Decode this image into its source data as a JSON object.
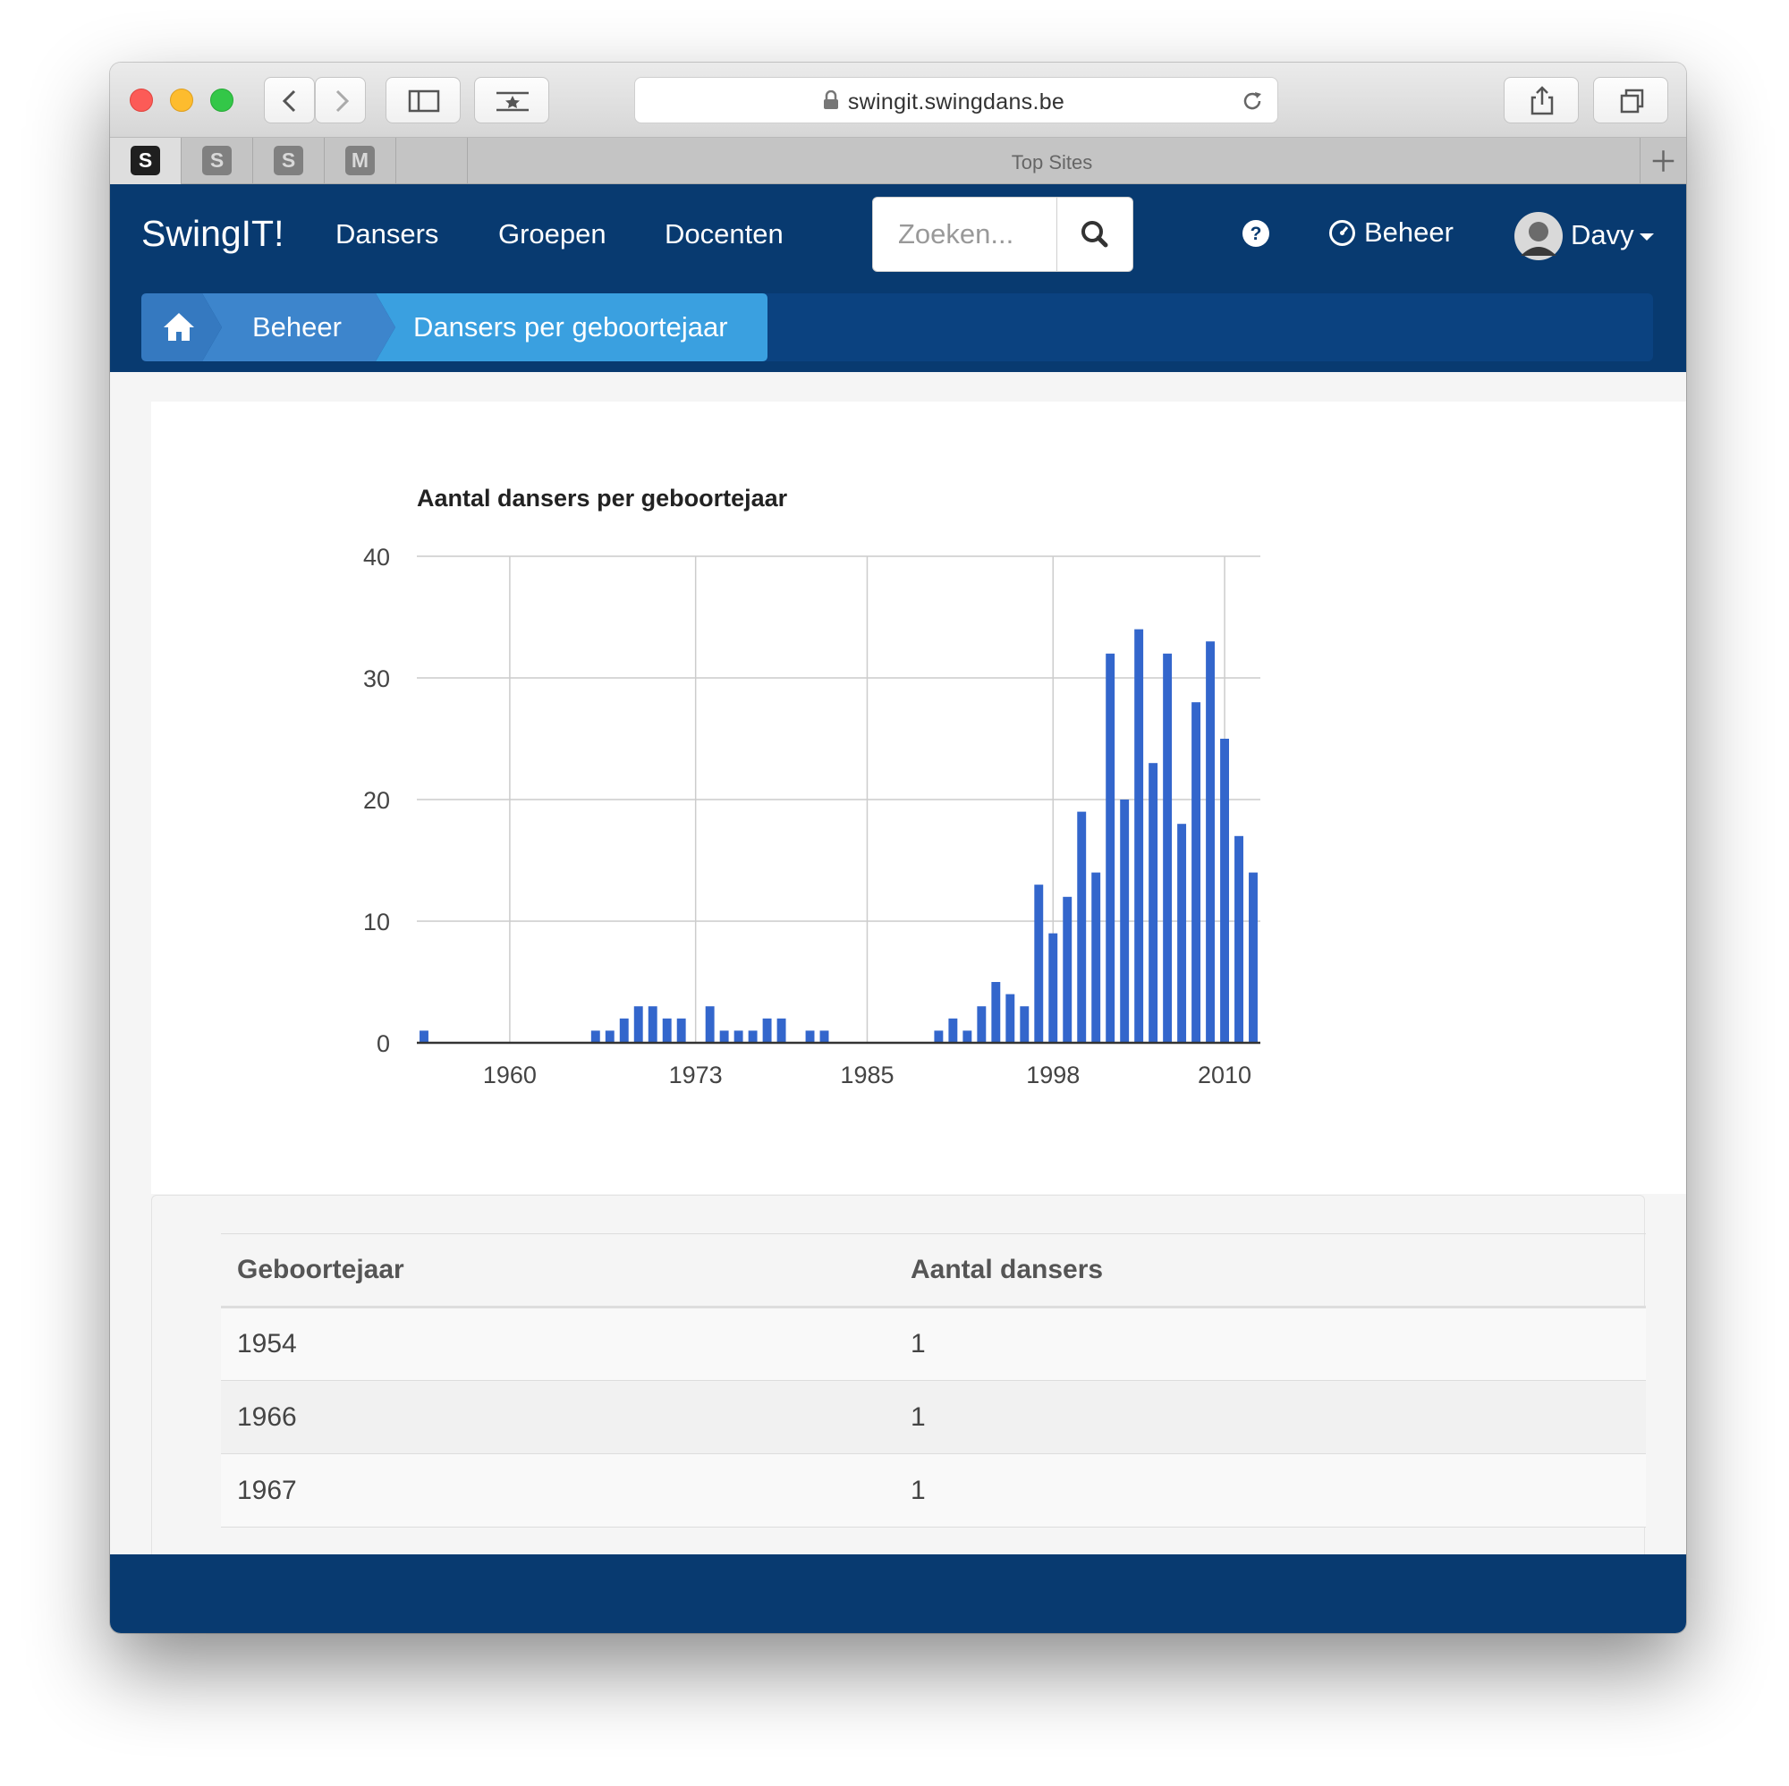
{
  "browser": {
    "url": "swingit.swingdans.be",
    "tab_title": "Top Sites",
    "pinned_tabs": [
      "S",
      "S",
      "S",
      "M"
    ]
  },
  "navbar": {
    "brand": "SwingIT!",
    "links": [
      "Dansers",
      "Groepen",
      "Docenten"
    ],
    "search_placeholder": "Zoeken...",
    "beheer_label": "Beheer",
    "user_name": "Davy"
  },
  "breadcrumb": {
    "items": [
      "Beheer",
      "Dansers per geboortejaar"
    ]
  },
  "chart_data": {
    "type": "bar",
    "title": "Aantal dansers per geboortejaar",
    "xlabel": "",
    "ylabel": "",
    "x_ticks": [
      "1960",
      "1973",
      "1985",
      "1998",
      "2010"
    ],
    "y_ticks": [
      "0",
      "10",
      "20",
      "30",
      "40"
    ],
    "ylim": [
      0,
      40
    ],
    "xlim": [
      1953.5,
      2012.5
    ],
    "grid": true,
    "color": "#3366cc",
    "x": [
      1954,
      1966,
      1967,
      1968,
      1969,
      1970,
      1971,
      1972,
      1974,
      1975,
      1976,
      1977,
      1978,
      1979,
      1981,
      1982,
      1990,
      1991,
      1992,
      1993,
      1994,
      1995,
      1996,
      1997,
      1998,
      1999,
      2000,
      2001,
      2002,
      2003,
      2004,
      2005,
      2006,
      2007,
      2008,
      2009,
      2010,
      2011,
      2012
    ],
    "values": [
      1,
      1,
      1,
      2,
      3,
      3,
      2,
      2,
      3,
      1,
      1,
      1,
      2,
      2,
      1,
      1,
      1,
      2,
      1,
      3,
      5,
      4,
      3,
      13,
      9,
      12,
      19,
      14,
      32,
      20,
      34,
      23,
      32,
      18,
      28,
      33,
      25,
      17,
      14
    ]
  },
  "table": {
    "headers": [
      "Geboortejaar",
      "Aantal dansers"
    ],
    "rows": [
      [
        "1954",
        "1"
      ],
      [
        "1966",
        "1"
      ],
      [
        "1967",
        "1"
      ]
    ]
  },
  "colors": {
    "navbar": "#083a70",
    "breadcrumb_active": "#3aa0e0",
    "bar": "#3366cc"
  }
}
